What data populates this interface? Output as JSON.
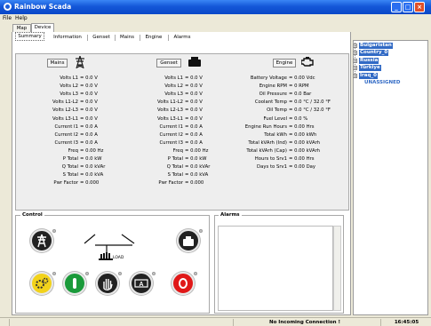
{
  "window": {
    "title": "Rainbow Scada"
  },
  "menu": {
    "file": "File",
    "help": "Help"
  },
  "main_tabs": [
    "Map",
    "Device"
  ],
  "sub_tabs": [
    "Summary",
    "Information",
    "Genset",
    "Mains",
    "Engine",
    "Alarms"
  ],
  "columns": {
    "mains": "Mains",
    "genset": "Genset",
    "engine": "Engine"
  },
  "mains_rows": [
    {
      "label": "Volts L1",
      "value": "= 0.0 V"
    },
    {
      "label": "Volts L2",
      "value": "= 0.0 V"
    },
    {
      "label": "Volts L3",
      "value": "= 0.0 V"
    },
    {
      "label": "Volts L1-L2",
      "value": "= 0.0 V"
    },
    {
      "label": "Volts L2-L3",
      "value": "= 0.0 V"
    },
    {
      "label": "Volts L3-L1",
      "value": "= 0.0 V"
    },
    {
      "label": "Current I1",
      "value": "= 0.0 A"
    },
    {
      "label": "Current I2",
      "value": "= 0.0 A"
    },
    {
      "label": "Current I3",
      "value": "= 0.0 A"
    },
    {
      "label": "Freq",
      "value": "= 0.00 Hz"
    },
    {
      "label": "P Total",
      "value": "= 0.0 kW"
    },
    {
      "label": "Q Total",
      "value": "= 0.0 kVAr"
    },
    {
      "label": "S Total",
      "value": "= 0.0 kVA"
    },
    {
      "label": "Pwr Factor",
      "value": "= 0.000"
    }
  ],
  "genset_rows": [
    {
      "label": "Volts L1",
      "value": "= 0.0 V"
    },
    {
      "label": "Volts L2",
      "value": "= 0.0 V"
    },
    {
      "label": "Volts L3",
      "value": "= 0.0 V"
    },
    {
      "label": "Volts L1-L2",
      "value": "= 0.0 V"
    },
    {
      "label": "Volts L2-L3",
      "value": "= 0.0 V"
    },
    {
      "label": "Volts L3-L1",
      "value": "= 0.0 V"
    },
    {
      "label": "Current I1",
      "value": "= 0.0 A"
    },
    {
      "label": "Current I2",
      "value": "= 0.0 A"
    },
    {
      "label": "Current I3",
      "value": "= 0.0 A"
    },
    {
      "label": "Freq",
      "value": "= 0.00 Hz"
    },
    {
      "label": "P Total",
      "value": "= 0.0 kW"
    },
    {
      "label": "Q Total",
      "value": "= 0.0 kVAr"
    },
    {
      "label": "S Total",
      "value": "= 0.0 kVA"
    },
    {
      "label": "Pwr Factor",
      "value": "= 0.000"
    }
  ],
  "engine_rows": [
    {
      "label": "Battery Voltage",
      "value": "= 0.00 Vdc"
    },
    {
      "label": "Engine RPM",
      "value": "= 0 RPM"
    },
    {
      "label": "Oil Pressure",
      "value": "= 0.0 Bar"
    },
    {
      "label": "Coolant Temp",
      "value": "= 0.0 °C / 32.0 °F"
    },
    {
      "label": "Oil Temp",
      "value": "= 0.0 °C / 32.0 °F"
    },
    {
      "label": "Fuel Level",
      "value": "= 0.0 %"
    },
    {
      "label": "Engine Run Hours",
      "value": "= 0.00 Hrs"
    },
    {
      "label": "Total kWh",
      "value": "= 0.00 kWh"
    },
    {
      "label": "Total kVArh (Ind)",
      "value": "= 0.00 kVArh"
    },
    {
      "label": "Total kVArh (Cap)",
      "value": "= 0.00 kVArh"
    },
    {
      "label": "Hours to Srv1",
      "value": "= 0.00 Hrs"
    },
    {
      "label": "Days to Srv1",
      "value": "= 0.00 Day"
    }
  ],
  "control": {
    "title": "Control",
    "load_label": "LOAD"
  },
  "alarms": {
    "title": "Alarms"
  },
  "tree": {
    "items": [
      "Bulgaristan",
      "Country_0",
      "Russia",
      "Türkiye",
      "Iraq_0"
    ],
    "unassigned": "UNASSIGNED"
  },
  "status": {
    "connection": "No Incoming Connection !",
    "time": "16:45:05"
  },
  "colors": {
    "selection": "#316ac5",
    "titlebar": "#1457d8"
  }
}
